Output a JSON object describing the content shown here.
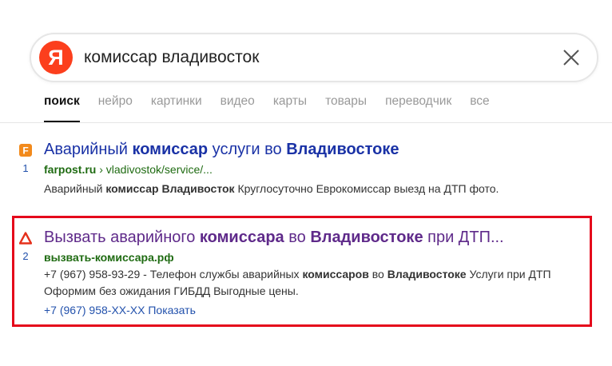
{
  "search": {
    "logo_letter": "Я",
    "query": "комиссар владивосток"
  },
  "tabs": [
    {
      "label": "поиск",
      "active": true
    },
    {
      "label": "нейро"
    },
    {
      "label": "картинки"
    },
    {
      "label": "видео"
    },
    {
      "label": "карты"
    },
    {
      "label": "товары"
    },
    {
      "label": "переводчик"
    },
    {
      "label": "все"
    }
  ],
  "results": [
    {
      "number": "1",
      "favicon_letter": "F",
      "title": {
        "t1": "Аварийный ",
        "b1": "комиссар",
        "t2": " услуги во ",
        "b2": "Владивостоке",
        "t3": ""
      },
      "url_host": "farpost.ru",
      "url_path": " › vladivostok/service/...",
      "snippet": {
        "t1": "Аварийный ",
        "b1": "комиссар Владивосток",
        "t2": " Круглосуточно Еврокомиссар выезд на ДТП фото."
      }
    },
    {
      "number": "2",
      "favicon_icon": "warning-triangle-icon",
      "title": {
        "t1": "Вызвать аварийного ",
        "b1": "комиссара",
        "t2": " во ",
        "b2": "Владивостоке",
        "t3": " при ДТП..."
      },
      "url_host": "вызвать-комиссара.рф",
      "snippet": {
        "t1": "+7 (967) 958-93-29 - Телефон службы аварийных ",
        "b1": "комиссаров",
        "t2": " во ",
        "b2": "Владивостоке",
        "t3": " Услуги при ДТП Оформим без ожидания ГИБДД Выгодные цены."
      },
      "phone": "+7 (967) 958-XX-XX Показать"
    }
  ],
  "colors": {
    "brand_red": "#fc3f1d",
    "title_link_1": "#1a32a6",
    "title_link_2_visited": "#5f2a8a",
    "url_green": "#1f6b12",
    "highlight_border": "#e5081b",
    "farpost_orange": "#f28a1c"
  }
}
